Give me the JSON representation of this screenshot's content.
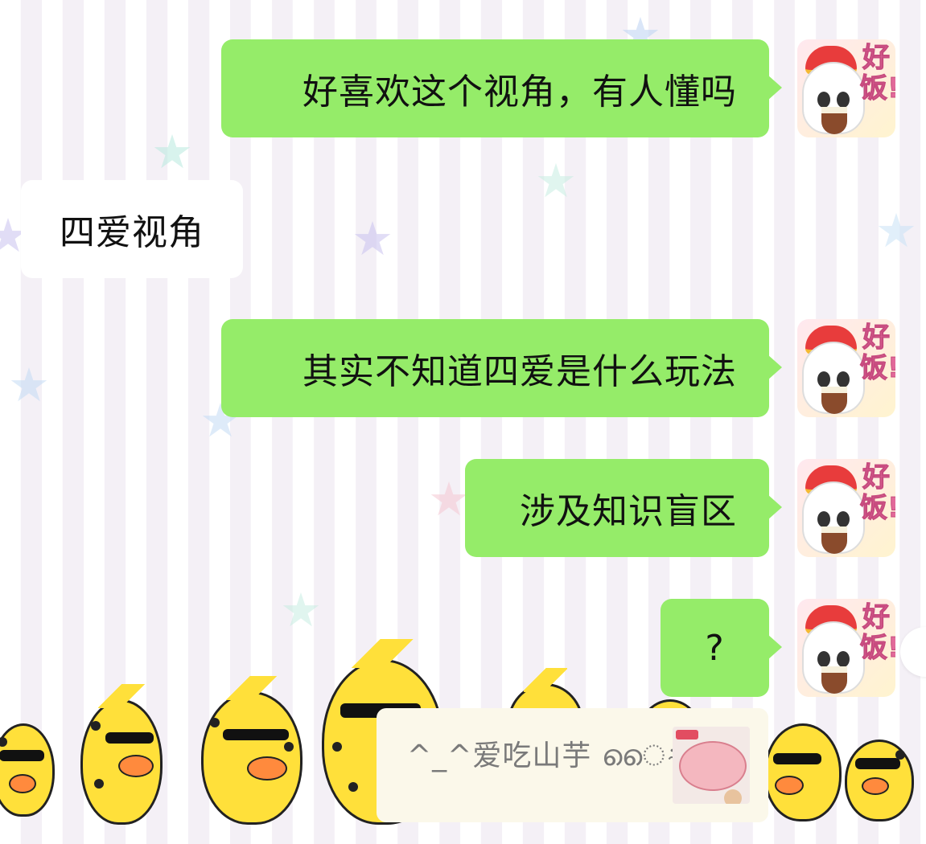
{
  "messages": [
    {
      "side": "me",
      "text": "好喜欢这个视角，有人懂吗"
    },
    {
      "side": "other",
      "text": "四爱视角"
    },
    {
      "side": "me",
      "text": "其实不知道四爱是什么玩法"
    },
    {
      "side": "me",
      "text": "涉及知识盲区"
    },
    {
      "side": "me",
      "text": "?"
    }
  ],
  "avatar": {
    "caption": "好饭!"
  },
  "quote": {
    "text": "^_^爱吃山芋 ൈ⍨:"
  },
  "colors": {
    "my_bubble": "#95ec69",
    "other_bubble": "#ffffff",
    "quote_bg": "#fbf8ea"
  }
}
